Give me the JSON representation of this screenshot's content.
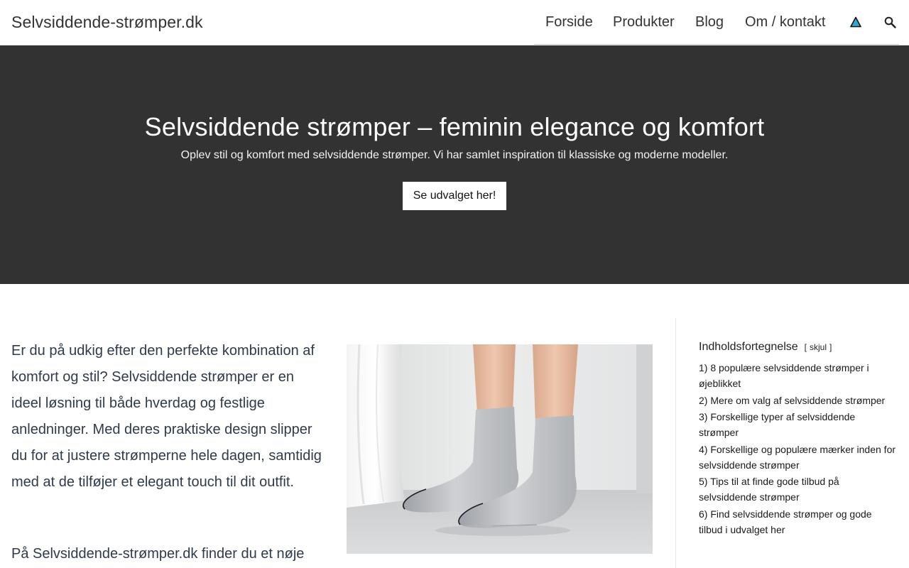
{
  "header": {
    "logo": "Selvsiddende-strømper.dk",
    "nav": [
      "Forside",
      "Produkter",
      "Blog",
      "Om / kontakt"
    ],
    "icons": [
      "warning-triangle-icon",
      "search-icon"
    ]
  },
  "hero": {
    "title": "Selvsiddende strømper – feminin elegance og komfort",
    "subtitle": "Oplev stil og komfort med selvsiddende strømper. Vi har samlet inspiration til klassiske og moderne modeller.",
    "button": "Se udvalget her!"
  },
  "content": {
    "intro": "Er du på udkig efter den perfekte kombination af komfort og stil? Selvsiddende strømper er en ideel løsning til både hverdag og festlige anledninger. Med deres praktiske design slipper du for at justere strømperne hele dagen, samtidig med at de tilføjer et elegant touch til dit outfit.",
    "para2": "På Selvsiddende-strømper.dk finder du et nøje"
  },
  "toc": {
    "title": "Indholdsfortegnelse",
    "toggle_open": "[",
    "toggle_label": "skjul",
    "toggle_close": "]",
    "items": [
      "1) 8 populære selvsiddende strømper i øjeblikket",
      "2) Mere om valg af selvsiddende strømper",
      "3) Forskellige typer af selvsiddende strømper",
      "4) Forskellige og populære mærker inden for selvsiddende strømper",
      "5) Tips til at finde gode tilbud på selvsiddende strømper",
      "6) Find selvsiddende strømper og gode tilbud i udvalget her"
    ]
  },
  "colors": {
    "hero_bg": "#323232",
    "text": "#2f3a4a",
    "icon_accent": "#2fa9d6"
  }
}
